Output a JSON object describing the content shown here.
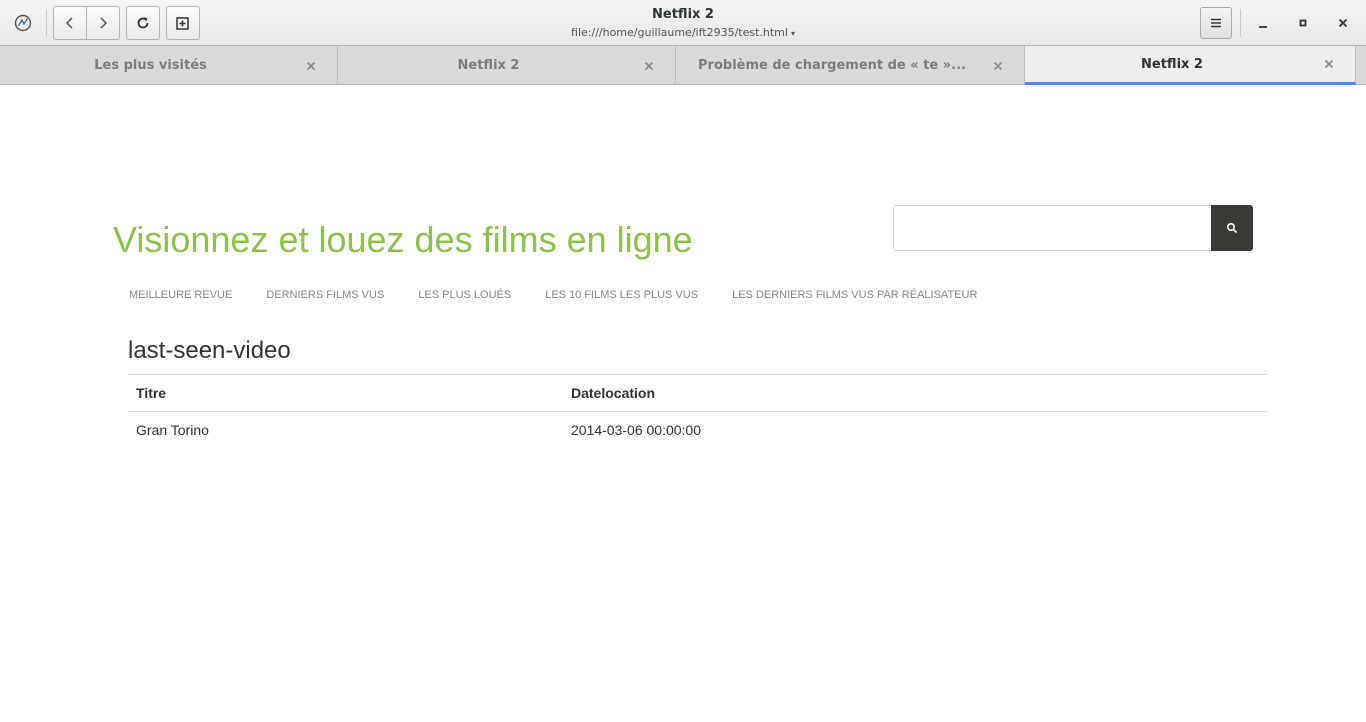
{
  "window": {
    "title": "Netflix 2",
    "url": "file:///home/guillaume/ift2935/test.html",
    "icons": {
      "app": "web-browser-icon",
      "back": "back-arrow-icon",
      "forward": "forward-arrow-icon",
      "reload": "reload-icon",
      "new_tab": "new-tab-icon",
      "menu": "hamburger-menu-icon",
      "minimize": "minimize-icon",
      "maximize": "maximize-icon",
      "close": "close-icon"
    }
  },
  "tabs": [
    {
      "label": "Les plus visités",
      "active": false
    },
    {
      "label": "Netflix 2",
      "active": false
    },
    {
      "label": "Problème de chargement de « te »...",
      "active": false
    },
    {
      "label": "Netflix 2",
      "active": true
    }
  ],
  "page": {
    "heading": "Visionnez et louez des films en ligne",
    "search": {
      "value": "",
      "placeholder": ""
    },
    "nav": [
      "MEILLEURE REVUE",
      "DERNIERS FILMS VUS",
      "LES PLUS LOUÉS",
      "LES 10 FILMS LES PLUS VUS",
      "LES DERNIERS FILMS VUS PAR RÉALISATEUR"
    ],
    "section_title": "last-seen-video",
    "table": {
      "headers": [
        "Titre",
        "Datelocation"
      ],
      "rows": [
        [
          "Gran Torino",
          "2014-03-06 00:00:00"
        ]
      ]
    }
  },
  "colors": {
    "heading": "#8dc04d",
    "active_tab_indicator": "#4a90d9",
    "search_button": "#3a3a37"
  }
}
